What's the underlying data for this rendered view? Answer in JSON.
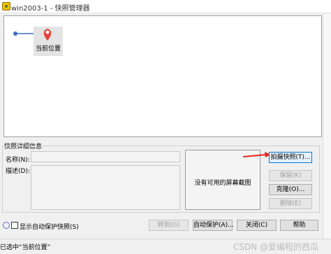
{
  "window": {
    "title": "win2003-1 - 快照管理器",
    "icon": "vmware-app-icon"
  },
  "snapshot_tree": {
    "root_icon": "snapshot-root-icon",
    "current_node": {
      "label": "当前位置",
      "icon": "location-pin-icon"
    }
  },
  "details": {
    "group_label": "快照详细信息",
    "name_label": "名称(N):",
    "name_value": "",
    "description_label": "描述(D):",
    "description_value": "",
    "preview_text": "没有可用的屏幕截图"
  },
  "actions": {
    "take_snapshot": "拍摄快照(T)...",
    "keep": "保留(K)",
    "clone": "克隆(O)...",
    "delete": "删除(E)"
  },
  "footer": {
    "checkbox_label": "显示自动保护快照(S)",
    "checkbox_checked": false,
    "goto": "转到(G)",
    "autoprotect": "自动保护(A)...",
    "close": "关闭(C)",
    "help": "帮助"
  },
  "status": {
    "text": "已选中“当前位置”"
  },
  "watermark": "CSDN @爱编程的西瓜",
  "colors": {
    "pin": "#e2453a",
    "arrow_annotation": "#e8261c",
    "link": "#3a6fc4"
  }
}
